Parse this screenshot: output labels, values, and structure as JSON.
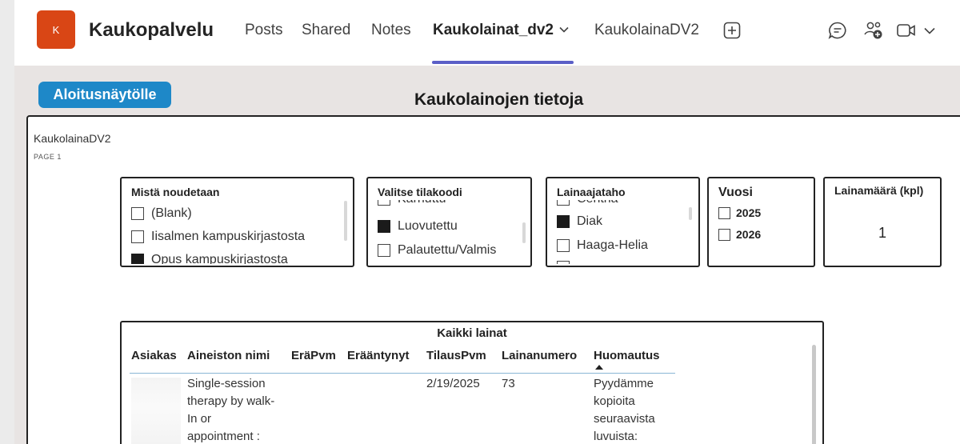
{
  "header": {
    "avatar_letter": "K",
    "team_name": "Kaukopalvelu",
    "tabs": [
      {
        "label": "Posts"
      },
      {
        "label": "Shared"
      },
      {
        "label": "Notes"
      },
      {
        "label": "Kaukolainat_dv2"
      },
      {
        "label": "KaukolainaDV2"
      }
    ],
    "active_tab_color": "#5b5fc7",
    "avatar_color": "#d94615"
  },
  "report": {
    "home_button": "Aloitusnäytölle",
    "title": "Kaukolainojen tietoja",
    "page_name": "KaukolainaDV2",
    "page_number": "PAGE 1",
    "button_color": "#1e88c8"
  },
  "slicers": {
    "pickup": {
      "title": "Mistä noudetaan",
      "options": [
        {
          "label": "(Blank)",
          "checked": false
        },
        {
          "label": "Iisalmen kampuskirjastosta",
          "checked": false
        },
        {
          "label": "Opus kampuskirjastosta",
          "checked": true
        }
      ]
    },
    "order_code": {
      "title": "Valitse tilakoodi",
      "options": [
        {
          "label": "Karhuttu",
          "checked": false
        },
        {
          "label": "Luovutettu",
          "checked": true
        },
        {
          "label": "Palautettu/Valmis",
          "checked": false
        }
      ]
    },
    "lender": {
      "title": "Lainaajataho",
      "options": [
        {
          "label": "Centria",
          "checked": false
        },
        {
          "label": "Diak",
          "checked": true
        },
        {
          "label": "Haaga-Helia",
          "checked": false
        }
      ]
    },
    "year": {
      "title": "Vuosi",
      "options": [
        {
          "label": "2025",
          "checked": false
        },
        {
          "label": "2026",
          "checked": false
        }
      ]
    }
  },
  "card": {
    "title": "Lainamäärä (kpl)",
    "value": "1"
  },
  "table": {
    "title": "Kaikki lainat",
    "columns": [
      "Asiakas",
      "Aineiston nimi",
      "EräPvm",
      "Erääntynyt",
      "TilausPvm",
      "Lainanumero",
      "Huomautus"
    ],
    "sorted_column": "Huomautus",
    "rows": [
      {
        "asiakas": "",
        "aineiston_nimi": [
          "Single-session",
          "therapy by walk-",
          "In or",
          "appointment :"
        ],
        "erapvm": "",
        "eraantynyt": "",
        "tilauspvm": "2/19/2025",
        "lainanumero": "73",
        "huomautus": [
          "Pyydämme",
          "kopioita",
          "seuraavista",
          "luvuista:"
        ]
      }
    ]
  }
}
